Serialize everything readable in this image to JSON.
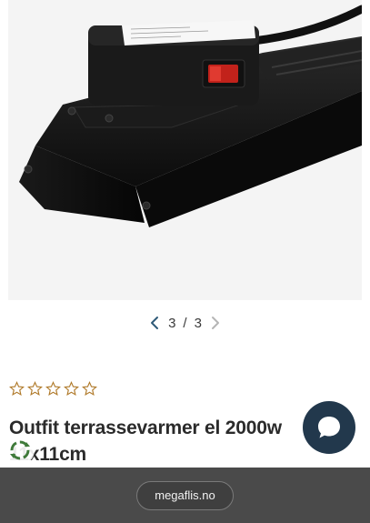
{
  "gallery": {
    "current": "3",
    "separator": "/",
    "total": "3",
    "prev_icon": "chevron-left-icon",
    "next_icon": "chevron-right-icon",
    "prev_color": "#2f5a78",
    "next_color": "#b5b5b5"
  },
  "product": {
    "rating": 0,
    "rating_max": 5,
    "star_color": "#b07a2a",
    "title": "Outfit terrassevarmer el 2000w 11x11cm"
  },
  "chat": {
    "icon": "chat-bubble-icon",
    "color": "#22384c"
  },
  "badge": {
    "icon": "recycle-icon",
    "color": "#3f7a3a"
  },
  "browser": {
    "url": "megaflis.no"
  }
}
